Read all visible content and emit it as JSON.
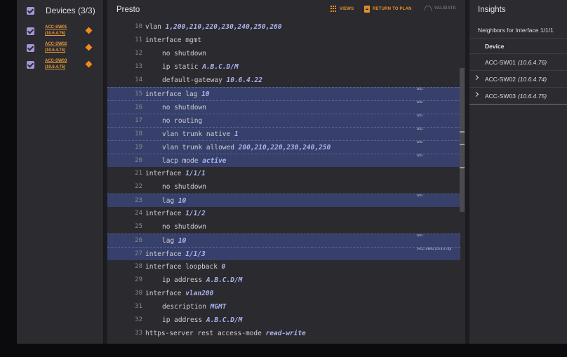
{
  "devices": {
    "title": "Devices (3/3)",
    "items": [
      {
        "name": "ACC-SW01",
        "ip": "(10.6.4.76)"
      },
      {
        "name": "ACC-SW02",
        "ip": "(10.6.4.74)"
      },
      {
        "name": "ACC-SW03",
        "ip": "(10.6.4.75)"
      }
    ]
  },
  "editor": {
    "title": "Presto",
    "toolbar": {
      "views": "VIEWS",
      "return_to_plan": "RETURN TO PLAN",
      "validate": "VALIDATE"
    },
    "lines": [
      {
        "n": "10",
        "indent": 0,
        "hl": false,
        "text": "vlan ",
        "val": "1,200,210,220,230,240,250,260",
        "tag": ""
      },
      {
        "n": "11",
        "indent": 0,
        "hl": false,
        "text": "interface mgmt",
        "val": "",
        "tag": ""
      },
      {
        "n": "12",
        "indent": 1,
        "hl": false,
        "text": "no shutdown",
        "val": "",
        "tag": ""
      },
      {
        "n": "13",
        "indent": 1,
        "hl": false,
        "text": "ip static ",
        "val": "A.B.C.D/M",
        "tag": ""
      },
      {
        "n": "14",
        "indent": 1,
        "hl": false,
        "text": "default-gateway ",
        "val": "10.6.4.22",
        "tag": ""
      },
      {
        "n": "15",
        "indent": 0,
        "hl": true,
        "text": "interface lag ",
        "val": "10",
        "tag": "0/11"
      },
      {
        "n": "16",
        "indent": 1,
        "hl": true,
        "text": "no shutdown",
        "val": "",
        "tag": "0/11"
      },
      {
        "n": "17",
        "indent": 1,
        "hl": true,
        "text": "no routing",
        "val": "",
        "tag": "0/11"
      },
      {
        "n": "18",
        "indent": 1,
        "hl": true,
        "text": "vlan trunk native ",
        "val": "1",
        "tag": "0/11"
      },
      {
        "n": "19",
        "indent": 1,
        "hl": true,
        "text": "vlan trunk allowed ",
        "val": "200,210,220,230,240,250",
        "tag": "0/11"
      },
      {
        "n": "20",
        "indent": 1,
        "hl": true,
        "text": "lacp mode ",
        "val": "active",
        "tag": "0/11"
      },
      {
        "n": "21",
        "indent": 0,
        "hl": false,
        "text": "interface ",
        "val": "1/1/1",
        "tag": ""
      },
      {
        "n": "22",
        "indent": 1,
        "hl": false,
        "text": "no shutdown",
        "val": "",
        "tag": ""
      },
      {
        "n": "23",
        "indent": 1,
        "hl": true,
        "text": "lag ",
        "val": "10",
        "tag": "0/11"
      },
      {
        "n": "24",
        "indent": 0,
        "hl": false,
        "text": "interface ",
        "val": "1/1/2",
        "tag": ""
      },
      {
        "n": "25",
        "indent": 1,
        "hl": false,
        "text": "no shutdown",
        "val": "",
        "tag": ""
      },
      {
        "n": "26",
        "indent": 1,
        "hl": true,
        "text": "lag ",
        "val": "10",
        "tag": "0/11"
      },
      {
        "n": "27",
        "indent": 0,
        "hl": true,
        "text": "interface ",
        "val": "1/1/3",
        "tag": "(ACC-SW02 (10.6.4.74))"
      },
      {
        "n": "28",
        "indent": 0,
        "hl": false,
        "text": "interface loopback ",
        "val": "0",
        "tag": ""
      },
      {
        "n": "29",
        "indent": 1,
        "hl": false,
        "text": "ip address ",
        "val": "A.B.C.D/M",
        "tag": ""
      },
      {
        "n": "30",
        "indent": 0,
        "hl": false,
        "text": "interface ",
        "val": "vlan200",
        "tag": ""
      },
      {
        "n": "31",
        "indent": 1,
        "hl": false,
        "text": "description ",
        "val": "MGMT",
        "tag": ""
      },
      {
        "n": "32",
        "indent": 1,
        "hl": false,
        "text": "ip address ",
        "val": "A.B.C.D/M",
        "tag": ""
      },
      {
        "n": "33",
        "indent": 0,
        "hl": false,
        "text": "https-server rest access-mode ",
        "val": "read-write",
        "tag": ""
      }
    ]
  },
  "insights": {
    "title": "Insights",
    "subtitle": "Neighbors for Interface 1/1/1",
    "column": "Device",
    "rows": [
      {
        "name": "ACC-SW01",
        "ip": "(10.6.4.76)",
        "expandable": false
      },
      {
        "name": "ACC-SW02",
        "ip": "(10.6.4.74)",
        "expandable": true
      },
      {
        "name": "ACC-SW03",
        "ip": "(10.6.4.75)",
        "expandable": true
      }
    ]
  },
  "colors": {
    "accent": "#e8902c",
    "highlight": "#37406a",
    "checkbox": "#a896d8"
  }
}
